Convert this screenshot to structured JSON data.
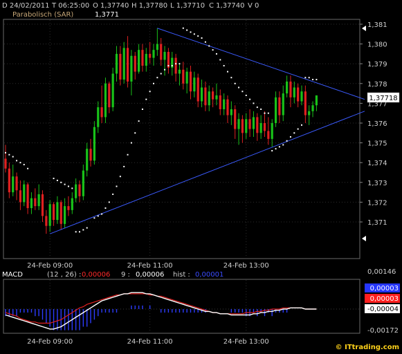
{
  "header": {
    "date": "D 24/02/2011",
    "time": "T 06:25:00",
    "open": "O 1,37740",
    "high": "H 1,37780",
    "low": "L 1,37710",
    "close": "C 1,37740",
    "volume": "V 0",
    "indicator_name": "Parabolisch (SAR)",
    "indicator_value": "1,3771"
  },
  "price_badge": "1,37718",
  "macd": {
    "label": "MACD",
    "params": "(12 , 26) :",
    "value1": "0,00006",
    "signal_period": "9 :",
    "value2": "0,00006",
    "hist_label": "hist :",
    "hist_value": "0,00001",
    "badge_blue": "0,00003",
    "badge_red": "0,00003",
    "badge_white": "-0,00004"
  },
  "watermark": "© ITtrading.com",
  "colors": {
    "up": "#19c219",
    "down": "#e02020",
    "sar": "#ffffff",
    "trendline": "#3b5bff",
    "macd_line": "#ffffff",
    "signal_line": "#e02020",
    "histogram": "#2d3cff"
  },
  "chart_data": [
    {
      "type": "candlestick",
      "title": "",
      "x_tick_labels": [
        "24-Feb 09:00",
        "24-Feb 11:00",
        "24-Feb 13:00"
      ],
      "y_ticks": [
        "1,381",
        "1,380",
        "1,379",
        "1,378",
        "1,377",
        "1,376",
        "1,375",
        "1,374",
        "1,373",
        "1,372",
        "1,371"
      ],
      "ylim": [
        1.3701,
        1.3813
      ],
      "grid": true,
      "candles": [
        [
          1.3742,
          1.3749,
          1.3735,
          1.3737
        ],
        [
          1.3737,
          1.374,
          1.3722,
          1.3725
        ],
        [
          1.3725,
          1.3739,
          1.3723,
          1.3733
        ],
        [
          1.3733,
          1.3735,
          1.3721,
          1.3726
        ],
        [
          1.3726,
          1.3731,
          1.3716,
          1.372
        ],
        [
          1.372,
          1.3731,
          1.3718,
          1.3729
        ],
        [
          1.3729,
          1.373,
          1.3714,
          1.3717
        ],
        [
          1.3717,
          1.3725,
          1.3714,
          1.3722
        ],
        [
          1.3722,
          1.3727,
          1.3716,
          1.3718
        ],
        [
          1.3718,
          1.3729,
          1.3716,
          1.3724
        ],
        [
          1.3724,
          1.3726,
          1.371,
          1.3713
        ],
        [
          1.3713,
          1.3716,
          1.3704,
          1.3708
        ],
        [
          1.3708,
          1.3721,
          1.3705,
          1.3719
        ],
        [
          1.3719,
          1.372,
          1.3708,
          1.3711
        ],
        [
          1.3711,
          1.3723,
          1.3709,
          1.372
        ],
        [
          1.372,
          1.3721,
          1.3706,
          1.3709
        ],
        [
          1.3709,
          1.3722,
          1.3707,
          1.3718
        ],
        [
          1.3718,
          1.3723,
          1.3713,
          1.3716
        ],
        [
          1.3716,
          1.3725,
          1.3714,
          1.3722
        ],
        [
          1.3722,
          1.3732,
          1.372,
          1.3729
        ],
        [
          1.3729,
          1.3731,
          1.372,
          1.3723
        ],
        [
          1.3723,
          1.3739,
          1.3721,
          1.3736
        ],
        [
          1.3736,
          1.375,
          1.3733,
          1.3747
        ],
        [
          1.3747,
          1.3752,
          1.3738,
          1.3741
        ],
        [
          1.3741,
          1.3761,
          1.3739,
          1.3758
        ],
        [
          1.3758,
          1.3771,
          1.3755,
          1.3768
        ],
        [
          1.3768,
          1.3779,
          1.376,
          1.3763
        ],
        [
          1.3763,
          1.3783,
          1.376,
          1.378
        ],
        [
          1.378,
          1.3781,
          1.3765,
          1.3768
        ],
        [
          1.3768,
          1.3788,
          1.3766,
          1.3785
        ],
        [
          1.3785,
          1.3799,
          1.3781,
          1.3795
        ],
        [
          1.3795,
          1.3799,
          1.3779,
          1.3782
        ],
        [
          1.3782,
          1.3801,
          1.378,
          1.3798
        ],
        [
          1.3798,
          1.3804,
          1.3778,
          1.3781
        ],
        [
          1.3781,
          1.3797,
          1.3774,
          1.3794
        ],
        [
          1.3794,
          1.3796,
          1.3782,
          1.3786
        ],
        [
          1.3786,
          1.38,
          1.3785,
          1.3797
        ],
        [
          1.3797,
          1.38,
          1.3786,
          1.3789
        ],
        [
          1.3789,
          1.3798,
          1.3786,
          1.3795
        ],
        [
          1.3795,
          1.3801,
          1.379,
          1.3793
        ],
        [
          1.3793,
          1.38,
          1.3789,
          1.3797
        ],
        [
          1.3797,
          1.3808,
          1.3794,
          1.38
        ],
        [
          1.38,
          1.3803,
          1.3789,
          1.3792
        ],
        [
          1.3792,
          1.3799,
          1.3784,
          1.3796
        ],
        [
          1.3796,
          1.3798,
          1.3785,
          1.3788
        ],
        [
          1.3788,
          1.3796,
          1.3784,
          1.3793
        ],
        [
          1.3793,
          1.3795,
          1.3781,
          1.3785
        ],
        [
          1.3785,
          1.379,
          1.3779,
          1.3787
        ],
        [
          1.3787,
          1.3791,
          1.3777,
          1.378
        ],
        [
          1.378,
          1.3788,
          1.3775,
          1.3786
        ],
        [
          1.3786,
          1.3789,
          1.3772,
          1.3776
        ],
        [
          1.3776,
          1.3786,
          1.3773,
          1.3783
        ],
        [
          1.3783,
          1.3785,
          1.3768,
          1.3771
        ],
        [
          1.3771,
          1.3782,
          1.3768,
          1.3778
        ],
        [
          1.3778,
          1.3781,
          1.3766,
          1.3769
        ],
        [
          1.3769,
          1.3779,
          1.3766,
          1.3776
        ],
        [
          1.3776,
          1.3778,
          1.3768,
          1.3772
        ],
        [
          1.3772,
          1.378,
          1.3769,
          1.3774
        ],
        [
          1.3774,
          1.3777,
          1.3764,
          1.3767
        ],
        [
          1.3767,
          1.3775,
          1.3764,
          1.3772
        ],
        [
          1.3772,
          1.3774,
          1.376,
          1.3764
        ],
        [
          1.3764,
          1.3771,
          1.3759,
          1.3767
        ],
        [
          1.3767,
          1.3769,
          1.3752,
          1.3757
        ],
        [
          1.3757,
          1.3765,
          1.3749,
          1.3762
        ],
        [
          1.3762,
          1.3764,
          1.375,
          1.3755
        ],
        [
          1.3755,
          1.3765,
          1.3752,
          1.3762
        ],
        [
          1.3762,
          1.3767,
          1.3753,
          1.3757
        ],
        [
          1.3757,
          1.3766,
          1.3753,
          1.3763
        ],
        [
          1.3763,
          1.3765,
          1.3751,
          1.3755
        ],
        [
          1.3755,
          1.3764,
          1.3752,
          1.376
        ],
        [
          1.376,
          1.3766,
          1.3753,
          1.3756
        ],
        [
          1.3756,
          1.3763,
          1.3749,
          1.3752
        ],
        [
          1.3752,
          1.3762,
          1.3748,
          1.376
        ],
        [
          1.376,
          1.3776,
          1.3758,
          1.3773
        ],
        [
          1.3773,
          1.3776,
          1.376,
          1.3764
        ],
        [
          1.3764,
          1.3779,
          1.3761,
          1.3775
        ],
        [
          1.3775,
          1.3784,
          1.3773,
          1.3781
        ],
        [
          1.3781,
          1.3784,
          1.3768,
          1.3773
        ],
        [
          1.3773,
          1.3781,
          1.377,
          1.3778
        ],
        [
          1.3778,
          1.378,
          1.3768,
          1.3771
        ],
        [
          1.3771,
          1.3779,
          1.3769,
          1.3776
        ],
        [
          1.3776,
          1.3779,
          1.376,
          1.3764
        ],
        [
          1.3764,
          1.3769,
          1.3759,
          1.3766
        ],
        [
          1.3766,
          1.3771,
          1.3763,
          1.3769
        ],
        [
          1.3769,
          1.3774,
          1.3766,
          1.3774
        ]
      ],
      "sar": [
        [
          0,
          1.3745
        ],
        [
          1,
          1.3744
        ],
        [
          2,
          1.3743
        ],
        [
          3,
          1.3741
        ],
        [
          4,
          1.374
        ],
        [
          5,
          1.3739
        ],
        [
          6,
          1.3737
        ],
        [
          13,
          1.3732
        ],
        [
          14,
          1.3731
        ],
        [
          15,
          1.373
        ],
        [
          16,
          1.3729
        ],
        [
          17,
          1.3728
        ],
        [
          18,
          1.3727
        ],
        [
          19,
          1.3705
        ],
        [
          20,
          1.3705
        ],
        [
          21,
          1.3706
        ],
        [
          22,
          1.3707
        ],
        [
          24,
          1.3712
        ],
        [
          25,
          1.3713
        ],
        [
          26,
          1.3714
        ],
        [
          27,
          1.3717
        ],
        [
          28,
          1.372
        ],
        [
          29,
          1.3724
        ],
        [
          30,
          1.3728
        ],
        [
          31,
          1.3733
        ],
        [
          32,
          1.3738
        ],
        [
          33,
          1.3744
        ],
        [
          34,
          1.375
        ],
        [
          35,
          1.3755
        ],
        [
          36,
          1.3761
        ],
        [
          37,
          1.3767
        ],
        [
          38,
          1.3772
        ],
        [
          39,
          1.3776
        ],
        [
          40,
          1.378
        ],
        [
          41,
          1.3783
        ],
        [
          42,
          1.3785
        ],
        [
          43,
          1.3787
        ],
        [
          44,
          1.3789
        ],
        [
          45,
          1.3789
        ],
        [
          46,
          1.379
        ],
        [
          47,
          1.379
        ],
        [
          48,
          1.3808
        ],
        [
          49,
          1.3807
        ],
        [
          50,
          1.3806
        ],
        [
          51,
          1.3805
        ],
        [
          52,
          1.3804
        ],
        [
          53,
          1.3803
        ],
        [
          54,
          1.3801
        ],
        [
          55,
          1.3799
        ],
        [
          56,
          1.3797
        ],
        [
          57,
          1.3795
        ],
        [
          58,
          1.3792
        ],
        [
          59,
          1.3789
        ],
        [
          60,
          1.3786
        ],
        [
          61,
          1.3783
        ],
        [
          62,
          1.378
        ],
        [
          63,
          1.3778
        ],
        [
          64,
          1.3776
        ],
        [
          65,
          1.3774
        ],
        [
          66,
          1.3772
        ],
        [
          67,
          1.377
        ],
        [
          68,
          1.3768
        ],
        [
          69,
          1.3767
        ],
        [
          70,
          1.3765
        ],
        [
          71,
          1.3765
        ],
        [
          72,
          1.3746
        ],
        [
          73,
          1.3747
        ],
        [
          74,
          1.3748
        ],
        [
          75,
          1.3749
        ],
        [
          76,
          1.3751
        ],
        [
          77,
          1.3753
        ],
        [
          78,
          1.3755
        ],
        [
          79,
          1.3757
        ],
        [
          80,
          1.3759
        ],
        [
          81,
          1.3783
        ],
        [
          82,
          1.3783
        ],
        [
          83,
          1.3782
        ],
        [
          84,
          1.3782
        ]
      ],
      "trendlines": [
        {
          "from": [
            12,
            1.3704
          ],
          "to": [
            97,
            1.3766
          ]
        },
        {
          "from": [
            41,
            1.3808
          ],
          "to": [
            97,
            1.3772
          ]
        }
      ]
    },
    {
      "type": "macd",
      "title": "MACD",
      "x_tick_labels": [
        "24-Feb 09:00",
        "24-Feb 11:00",
        "24-Feb 13:00"
      ],
      "y_ticks": [
        "0,00146",
        "-0,00172"
      ],
      "ylim": [
        -0.0019,
        0.0018
      ],
      "grid": true,
      "macd": [
        -0.0005,
        -0.0006,
        -0.0007,
        -0.0008,
        -0.0009,
        -0.001,
        -0.0011,
        -0.0012,
        -0.0013,
        -0.0014,
        -0.0015,
        -0.0016,
        -0.0017,
        -0.0017,
        -0.0016,
        -0.0015,
        -0.0013,
        -0.0011,
        -0.0009,
        -0.0007,
        -0.0005,
        -0.0003,
        -0.0001,
        0.0001,
        0.0003,
        0.0005,
        0.0007,
        0.0008,
        0.0009,
        0.001,
        0.0011,
        0.0012,
        0.0013,
        0.0013,
        0.0014,
        0.0014,
        0.0014,
        0.0014,
        0.0013,
        0.0013,
        0.0012,
        0.0011,
        0.001,
        0.0009,
        0.0008,
        0.0007,
        0.0006,
        0.0005,
        0.0004,
        0.0003,
        0.0002,
        0.0001,
        0.0,
        -0.0001,
        -0.0002,
        -0.0002,
        -0.0003,
        -0.0003,
        -0.0004,
        -0.0004,
        -0.0004,
        -0.0005,
        -0.0005,
        -0.0005,
        -0.0005,
        -0.0005,
        -0.0005,
        -0.0004,
        -0.0004,
        -0.0003,
        -0.0003,
        -0.0002,
        -0.0002,
        -0.0001,
        -0.0001,
        0.0,
        0.0,
        0.0001,
        0.0001,
        0.0001,
        0.0001,
        0.0,
        0.0,
        0.0,
        -0.0
      ],
      "signal": [
        -0.0003,
        -0.0004,
        -0.0005,
        -0.0006,
        -0.0008,
        -0.0009,
        -0.001,
        -0.0011,
        -0.0011,
        -0.0012,
        -0.0012,
        -0.0012,
        -0.0012,
        -0.0011,
        -0.001,
        -0.0009,
        -0.0007,
        -0.0005,
        -0.0003,
        -0.0001,
        0.0001,
        0.0002,
        0.0004,
        0.0005,
        0.0006,
        0.0007,
        0.0008,
        0.0009,
        0.001,
        0.0011,
        0.0012,
        0.0012,
        0.0013,
        0.0013,
        0.0013,
        0.0013,
        0.0013,
        0.0013,
        0.0013,
        0.0012,
        0.0012,
        0.0011,
        0.0011,
        0.001,
        0.0009,
        0.0008,
        0.0007,
        0.0006,
        0.0005,
        0.0004,
        0.0003,
        0.0002,
        0.0001,
        0.0,
        -0.0001,
        -0.0002,
        -0.0003,
        -0.0003,
        -0.0004,
        -0.0004,
        -0.0004,
        -0.0004,
        -0.0004,
        -0.0004,
        -0.0004,
        -0.0003,
        -0.0003,
        -0.0003,
        -0.0002,
        -0.0002,
        -0.0001,
        -0.0001,
        0.0,
        0.0,
        0.0,
        0.0001,
        0.0001,
        0.0001,
        0.0001,
        0.0001,
        0.0001,
        0.0,
        0.0,
        0.0,
        -0.0
      ]
    }
  ]
}
